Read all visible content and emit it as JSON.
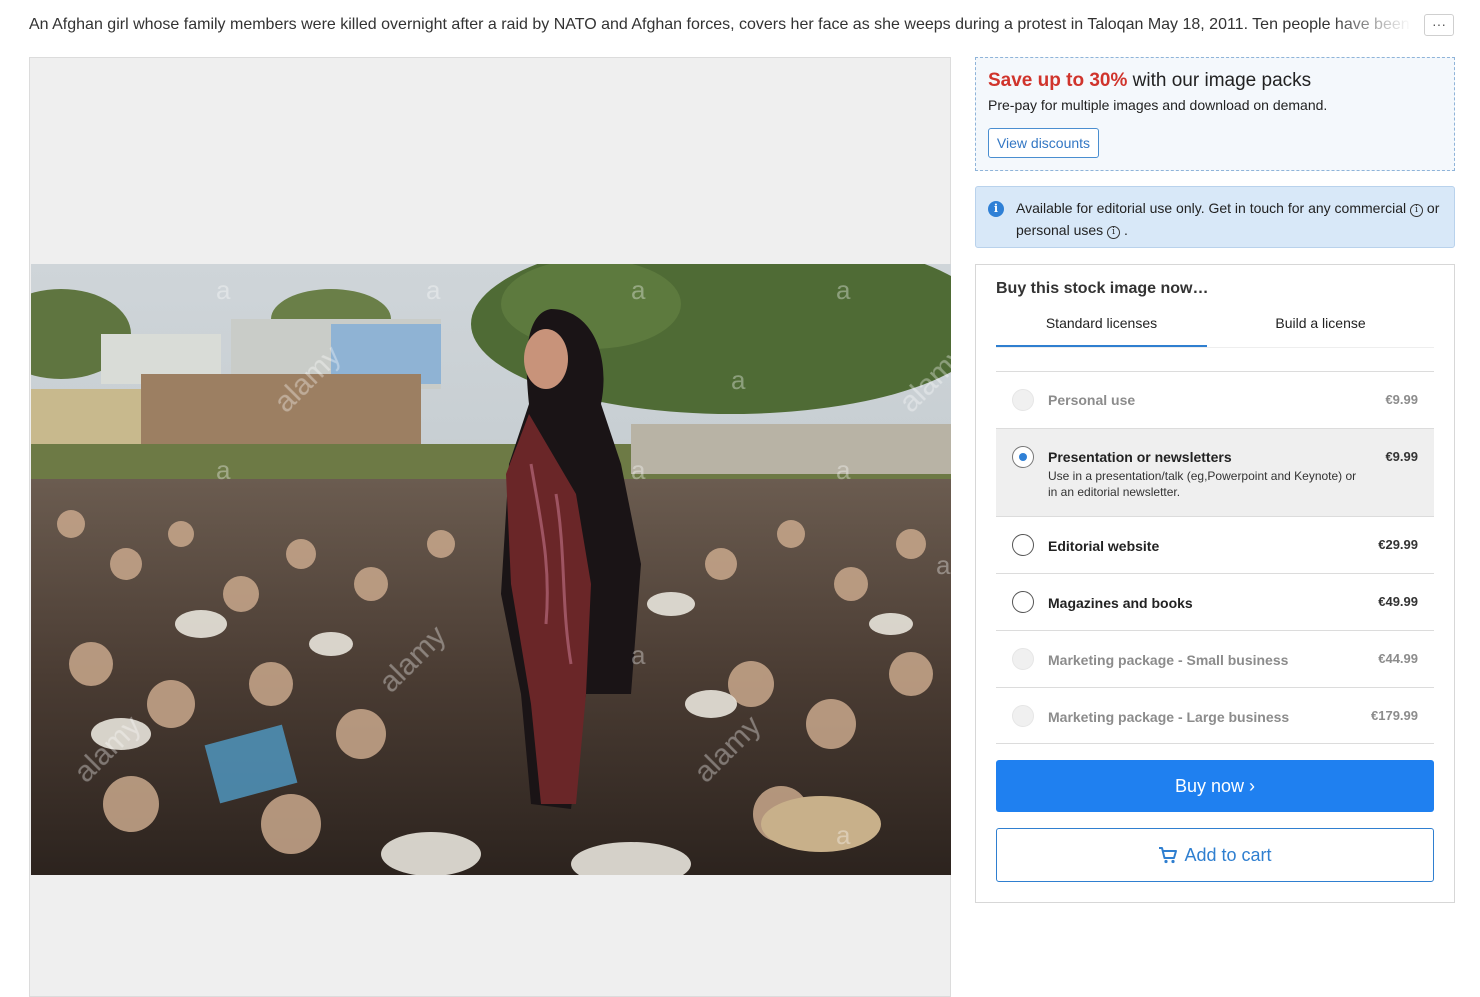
{
  "caption": {
    "text": "An Afghan girl whose family members were killed overnight after a raid by NATO and Afghan forces, covers her face as she weeps during a protest in Taloqan May 18, 2011. Ten people have been k",
    "more_label": "···"
  },
  "image": {
    "watermark": "alamy",
    "watermark_letter": "a"
  },
  "packs": {
    "highlight": "Save up to 30%",
    "title_rest": " with our image packs",
    "subtitle": "Pre-pay for multiple images and download on demand.",
    "button_label": "View discounts"
  },
  "notice": {
    "icon": "i",
    "text_part1": "Available for editorial use only. Get in touch for any commercial ",
    "text_part2": " or personal uses ",
    "text_part3": " .",
    "info_glyph": "i"
  },
  "buy_box": {
    "title": "Buy this stock image now…",
    "tabs": [
      {
        "label": "Standard licenses",
        "active": true
      },
      {
        "label": "Build a license",
        "active": false
      }
    ],
    "options": [
      {
        "name": "Personal use",
        "price": "€9.99",
        "description": "",
        "disabled": true,
        "selected": false
      },
      {
        "name": "Presentation or newsletters",
        "price": "€9.99",
        "description": "Use in a presentation/talk (eg,Powerpoint and Keynote) or in an editorial newsletter.",
        "disabled": false,
        "selected": true
      },
      {
        "name": "Editorial website",
        "price": "€29.99",
        "description": "",
        "disabled": false,
        "selected": false
      },
      {
        "name": "Magazines and books",
        "price": "€49.99",
        "description": "",
        "disabled": false,
        "selected": false
      },
      {
        "name": "Marketing package - Small business",
        "price": "€44.99",
        "description": "",
        "disabled": true,
        "selected": false
      },
      {
        "name": "Marketing package - Large business",
        "price": "€179.99",
        "description": "",
        "disabled": true,
        "selected": false
      }
    ],
    "buy_label": "Buy now ›",
    "cart_label": "Add to cart"
  },
  "colors": {
    "accent": "#1f80f0",
    "highlight_red": "#d0342c",
    "notice_bg": "#d8e8f8"
  }
}
